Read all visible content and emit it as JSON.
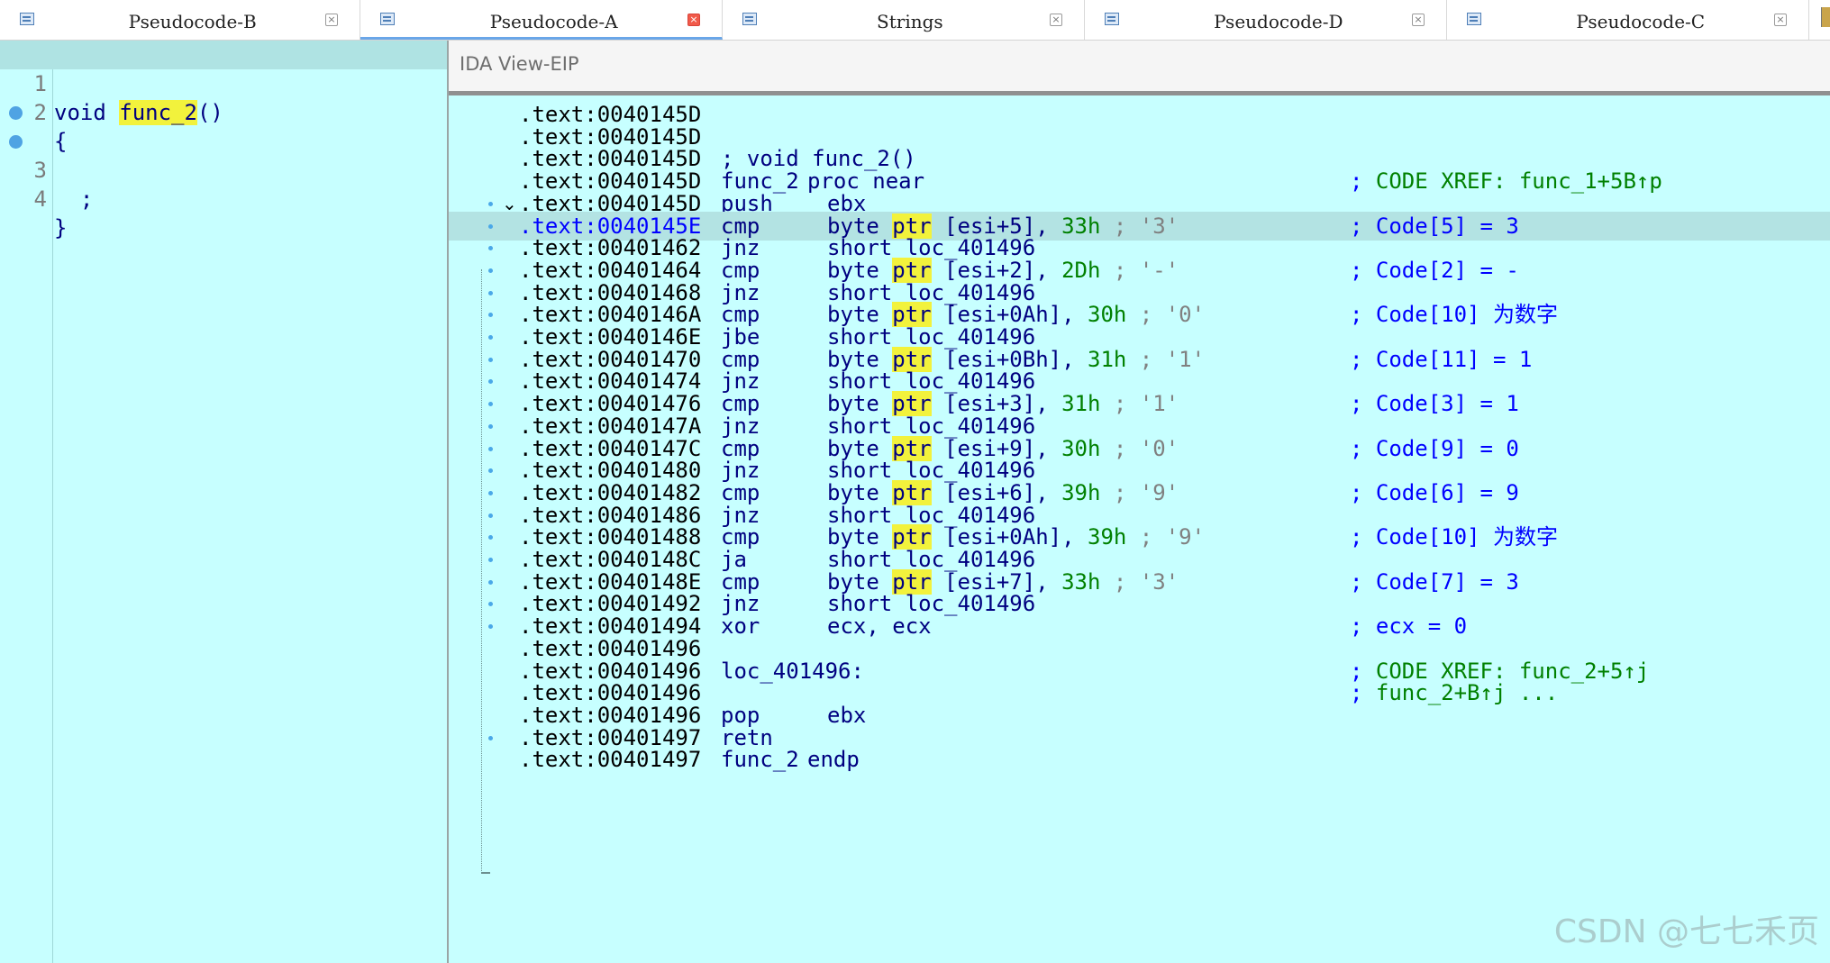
{
  "tabs": [
    {
      "label": "Pseudocode-B",
      "active": false
    },
    {
      "label": "Pseudocode-A",
      "active": true
    },
    {
      "label": "Strings",
      "active": false
    },
    {
      "label": "Pseudocode-D",
      "active": false
    },
    {
      "label": "Pseudocode-C",
      "active": false
    }
  ],
  "pseudocode": {
    "lines": [
      {
        "num": "1",
        "pre": "void ",
        "func": "func_2",
        "post": "()"
      },
      {
        "num": "2",
        "text": "{"
      },
      {
        "num": "3",
        "text": "  ;"
      },
      {
        "num": "4",
        "text": "}"
      }
    ]
  },
  "ida_view": {
    "title": "IDA View-EIP",
    "lines": [
      {
        "addr": ".text:0040145D"
      },
      {
        "addr": ".text:0040145D"
      },
      {
        "addr": ".text:0040145D",
        "label": "; void func_2()"
      },
      {
        "addr": ".text:0040145D",
        "mn": "func_2",
        "op": "proc near",
        "cm_prefix": "; ",
        "cm": "CODE XREF: func_1+5B↑p"
      },
      {
        "addr": ".text:0040145D",
        "mn": "push",
        "op": "ebx"
      },
      {
        "addr": ".text:0040145E",
        "mn": "cmp",
        "op_pre": "byte ",
        "op_ptr": "ptr",
        "op_mem": " [esi+5], ",
        "op_num": "33h",
        "op_chr": " ; '3'",
        "cm": "; Code[5] = 3"
      },
      {
        "addr": ".text:00401462",
        "mn": "jnz",
        "op": "short loc_401496"
      },
      {
        "addr": ".text:00401464",
        "mn": "cmp",
        "op_pre": "byte ",
        "op_ptr": "ptr",
        "op_mem": " [esi+2], ",
        "op_num": "2Dh",
        "op_chr": " ; '-'",
        "cm": "; Code[2] = -"
      },
      {
        "addr": ".text:00401468",
        "mn": "jnz",
        "op": "short loc_401496"
      },
      {
        "addr": ".text:0040146A",
        "mn": "cmp",
        "op_pre": "byte ",
        "op_ptr": "ptr",
        "op_mem": " [esi+0Ah], ",
        "op_num": "30h",
        "op_chr": " ; '0'",
        "cm": "; Code[10] 为数字"
      },
      {
        "addr": ".text:0040146E",
        "mn": "jbe",
        "op": "short loc_401496"
      },
      {
        "addr": ".text:00401470",
        "mn": "cmp",
        "op_pre": "byte ",
        "op_ptr": "ptr",
        "op_mem": " [esi+0Bh], ",
        "op_num": "31h",
        "op_chr": " ; '1'",
        "cm": "; Code[11] = 1"
      },
      {
        "addr": ".text:00401474",
        "mn": "jnz",
        "op": "short loc_401496"
      },
      {
        "addr": ".text:00401476",
        "mn": "cmp",
        "op_pre": "byte ",
        "op_ptr": "ptr",
        "op_mem": " [esi+3], ",
        "op_num": "31h",
        "op_chr": " ; '1'",
        "cm": "; Code[3] = 1"
      },
      {
        "addr": ".text:0040147A",
        "mn": "jnz",
        "op": "short loc_401496"
      },
      {
        "addr": ".text:0040147C",
        "mn": "cmp",
        "op_pre": "byte ",
        "op_ptr": "ptr",
        "op_mem": " [esi+9], ",
        "op_num": "30h",
        "op_chr": " ; '0'",
        "cm": "; Code[9] = 0"
      },
      {
        "addr": ".text:00401480",
        "mn": "jnz",
        "op": "short loc_401496"
      },
      {
        "addr": ".text:00401482",
        "mn": "cmp",
        "op_pre": "byte ",
        "op_ptr": "ptr",
        "op_mem": " [esi+6], ",
        "op_num": "39h",
        "op_chr": " ; '9'",
        "cm": "; Code[6] = 9"
      },
      {
        "addr": ".text:00401486",
        "mn": "jnz",
        "op": "short loc_401496"
      },
      {
        "addr": ".text:00401488",
        "mn": "cmp",
        "op_pre": "byte ",
        "op_ptr": "ptr",
        "op_mem": " [esi+0Ah], ",
        "op_num": "39h",
        "op_chr": " ; '9'",
        "cm": "; Code[10] 为数字"
      },
      {
        "addr": ".text:0040148C",
        "mn": "ja",
        "op": "short loc_401496"
      },
      {
        "addr": ".text:0040148E",
        "mn": "cmp",
        "op_pre": "byte ",
        "op_ptr": "ptr",
        "op_mem": " [esi+7], ",
        "op_num": "33h",
        "op_chr": " ; '3'",
        "cm": "; Code[7] = 3"
      },
      {
        "addr": ".text:00401492",
        "mn": "jnz",
        "op": "short loc_401496"
      },
      {
        "addr": ".text:00401494",
        "mn": "xor",
        "op": "ecx, ecx",
        "cm": "; ecx = 0"
      },
      {
        "addr": ".text:00401496"
      },
      {
        "addr": ".text:00401496",
        "label": "loc_401496:",
        "cm_prefix": "; ",
        "cm": "CODE XREF: func_2+5↑j"
      },
      {
        "addr": ".text:00401496",
        "cm_prefix": "; ",
        "cm": "func_2+B↑j ..."
      },
      {
        "addr": ".text:00401496",
        "mn": "pop",
        "op": "ebx"
      },
      {
        "addr": ".text:00401497",
        "mn": "retn"
      },
      {
        "addr": ".text:00401497",
        "mn": "func_2",
        "op": "endp"
      }
    ]
  },
  "watermark": "CSDN @七七禾页"
}
